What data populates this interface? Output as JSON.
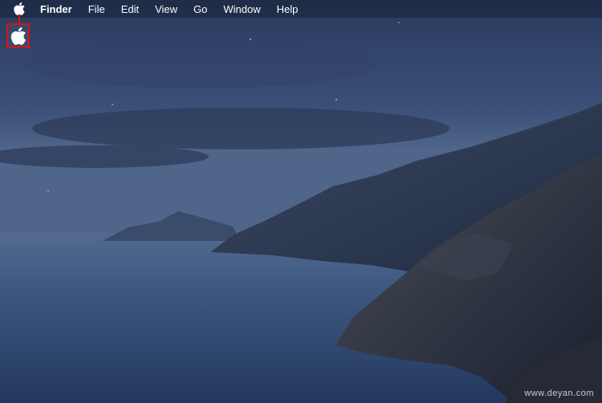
{
  "menubar": {
    "apple_menu_icon": "apple-logo-icon",
    "app_name": "Finder",
    "items": [
      {
        "label": "File"
      },
      {
        "label": "Edit"
      },
      {
        "label": "View"
      },
      {
        "label": "Go"
      },
      {
        "label": "Window"
      },
      {
        "label": "Help"
      }
    ]
  },
  "callout": {
    "icon": "apple-logo-icon",
    "color": "#e01010"
  },
  "desktop": {
    "wallpaper": "macos-catalina-night-coast"
  },
  "watermark": {
    "text": "www.deyan.com"
  },
  "colors": {
    "menubar_bg": "#202c48",
    "highlight_red": "#e01010",
    "sea": "#3c5479",
    "sky": "#3a4f74"
  }
}
